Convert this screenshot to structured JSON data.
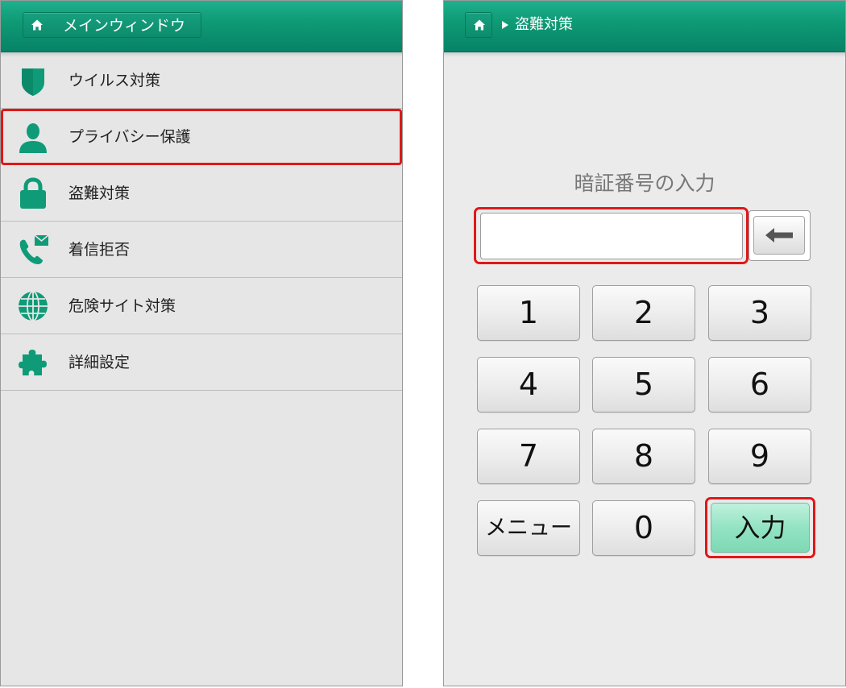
{
  "left_panel": {
    "header": {
      "title": "メインウィンドウ"
    },
    "menu_items": [
      {
        "label": "ウイルス対策",
        "icon": "shield-icon"
      },
      {
        "label": "プライバシー保護",
        "icon": "person-icon",
        "highlighted": true
      },
      {
        "label": "盗難対策",
        "icon": "lock-icon"
      },
      {
        "label": "着信拒否",
        "icon": "phone-mail-icon"
      },
      {
        "label": "危険サイト対策",
        "icon": "globe-icon"
      },
      {
        "label": "詳細設定",
        "icon": "puzzle-icon"
      }
    ]
  },
  "right_panel": {
    "header": {
      "breadcrumb": "盗難対策"
    },
    "pin_title": "暗証番号の入力",
    "pin_input": {
      "value": "",
      "placeholder": ""
    },
    "keypad": {
      "keys": [
        "1",
        "2",
        "3",
        "4",
        "5",
        "6",
        "7",
        "8",
        "9",
        "メニュー",
        "0"
      ],
      "enter_label": "入力"
    }
  },
  "colors": {
    "header_green": "#0f9b76",
    "icon_green": "#0f9b78",
    "highlight_red": "#e01818",
    "enter_green": "#93e3c3"
  }
}
